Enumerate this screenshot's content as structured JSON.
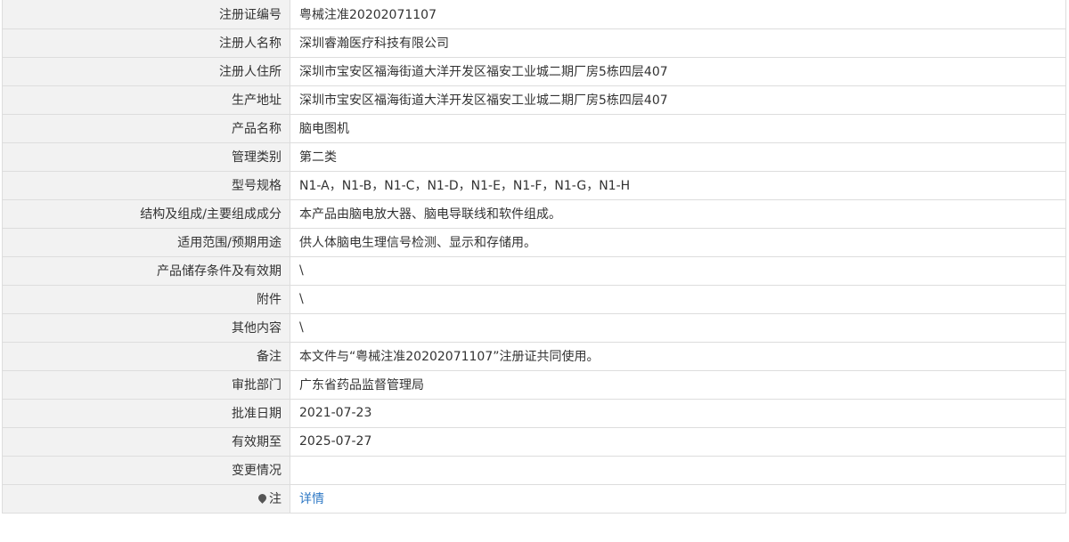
{
  "rows": [
    {
      "label": "注册证编号",
      "value": "粤械注准20202071107"
    },
    {
      "label": "注册人名称",
      "value": "深圳睿瀚医疗科技有限公司"
    },
    {
      "label": "注册人住所",
      "value": "深圳市宝安区福海街道大洋开发区福安工业城二期厂房5栋四层407"
    },
    {
      "label": "生产地址",
      "value": "深圳市宝安区福海街道大洋开发区福安工业城二期厂房5栋四层407"
    },
    {
      "label": "产品名称",
      "value": "脑电图机"
    },
    {
      "label": "管理类别",
      "value": "第二类"
    },
    {
      "label": "型号规格",
      "value": "N1-A，N1-B，N1-C，N1-D，N1-E，N1-F，N1-G，N1-H"
    },
    {
      "label": "结构及组成/主要组成成分",
      "value": "本产品由脑电放大器、脑电导联线和软件组成。"
    },
    {
      "label": "适用范围/预期用途",
      "value": "供人体脑电生理信号检测、显示和存储用。"
    },
    {
      "label": "产品储存条件及有效期",
      "value": "\\"
    },
    {
      "label": "附件",
      "value": "\\"
    },
    {
      "label": "其他内容",
      "value": "\\"
    },
    {
      "label": "备注",
      "value": "本文件与“粤械注准20202071107”注册证共同使用。"
    },
    {
      "label": "审批部门",
      "value": "广东省药品监督管理局"
    },
    {
      "label": "批准日期",
      "value": "2021-07-23"
    },
    {
      "label": "有效期至",
      "value": "2025-07-27"
    },
    {
      "label": "变更情况",
      "value": ""
    }
  ],
  "note_row": {
    "icon": "map-pin-icon",
    "label": "注",
    "link": "详情"
  },
  "colors": {
    "label_bg": "#f2f2f2",
    "border": "#dddddd",
    "link": "#2f79c5",
    "text": "#333333"
  }
}
